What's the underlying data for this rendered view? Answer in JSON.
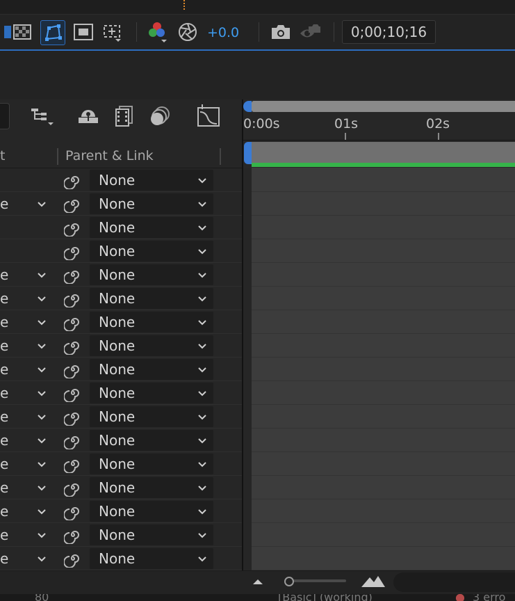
{
  "viewer_toolbar": {
    "exposure_value": "+0.0",
    "timecode": "0;00;10;16",
    "icons": [
      "checkerboard-icon",
      "mask-path-icon",
      "safe-zones-icon",
      "region-of-interest-icon",
      "color-channels-icon",
      "exposure-icon",
      "snapshot-icon",
      "show-snapshot-icon"
    ]
  },
  "layer_panel": {
    "columns": {
      "mode_partial": "t",
      "parent_link": "Parent & Link"
    },
    "switch_icons": [
      "flowchart-icon",
      "draft-3d-icon",
      "frame-blending-icon",
      "motion-blur-icon",
      "graph-editor-icon"
    ],
    "rows": [
      {
        "mode": "",
        "parent": "None"
      },
      {
        "mode": "e",
        "parent": "None"
      },
      {
        "mode": "",
        "parent": "None"
      },
      {
        "mode": "",
        "parent": "None"
      },
      {
        "mode": "e",
        "parent": "None"
      },
      {
        "mode": "e",
        "parent": "None"
      },
      {
        "mode": "e",
        "parent": "None"
      },
      {
        "mode": "e",
        "parent": "None"
      },
      {
        "mode": "e",
        "parent": "None"
      },
      {
        "mode": "e",
        "parent": "None"
      },
      {
        "mode": "e",
        "parent": "None"
      },
      {
        "mode": "e",
        "parent": "None"
      },
      {
        "mode": "e",
        "parent": "None"
      },
      {
        "mode": "e",
        "parent": "None"
      },
      {
        "mode": "e",
        "parent": "None"
      },
      {
        "mode": "e",
        "parent": "None"
      },
      {
        "mode": "e",
        "parent": "None"
      }
    ]
  },
  "timeline": {
    "ruler_labels": [
      "0:00s",
      "01s",
      "02s"
    ],
    "colors": {
      "work_area": "#8a8a8a",
      "layer_bar": "#707070",
      "layer_bar_accent": "#36b34a",
      "marker": "#3a7bd5"
    }
  },
  "footer": {
    "zoom_icons": [
      "zoom-out-mountain-icon",
      "zoom-in-mountain-icon"
    ]
  },
  "bottom_strip": {
    "left_text": "80",
    "middle_text": "[Basic] (working)",
    "right_text": "3 erro"
  }
}
